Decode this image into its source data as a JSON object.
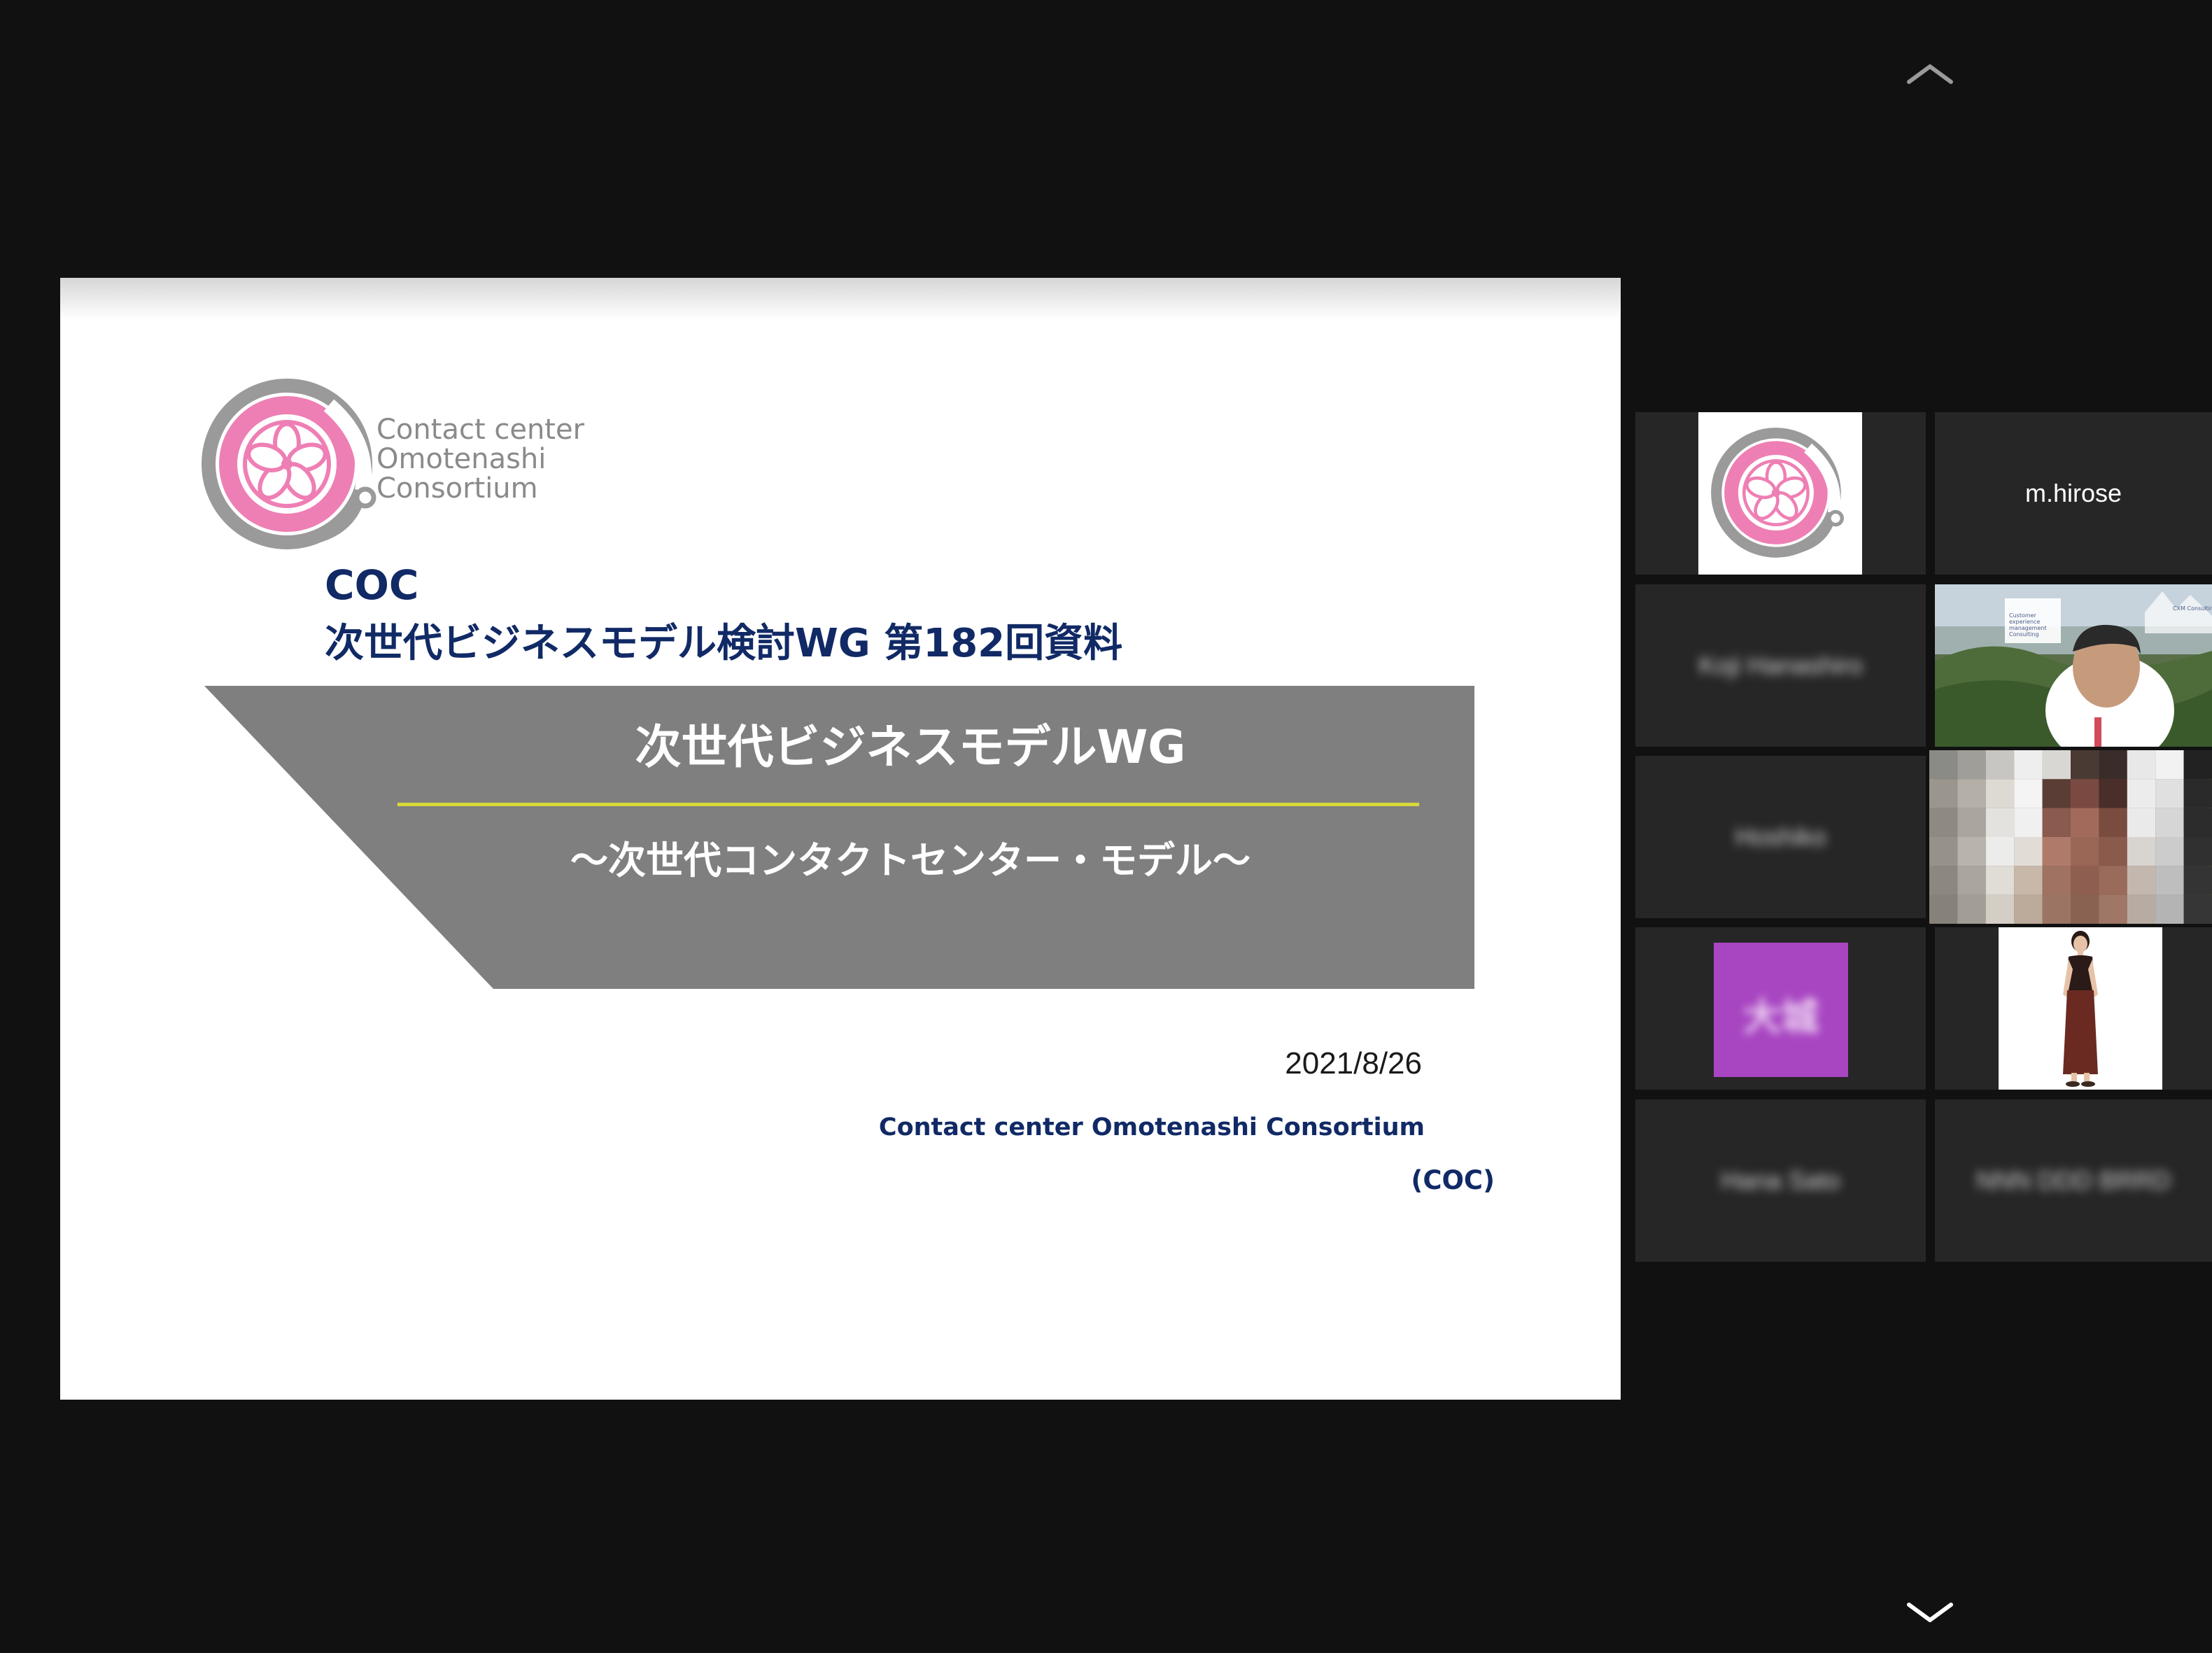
{
  "controls": {
    "scroll_up_icon": "chevron-up-icon",
    "scroll_down_icon": "chevron-down-icon"
  },
  "slide": {
    "logo_lines": [
      "Contact center",
      "Omotenashi",
      "Consortium"
    ],
    "heading_line_1": "COC",
    "heading_line_2": "次世代ビジネスモデル検討WG 第182回資料",
    "banner_title": "次世代ビジネスモデルWG",
    "banner_subtitle": "～次世代コンタクトセンター・モデル～",
    "date": "2021/8/26",
    "organization": "Contact center Omotenashi Consortium",
    "organization_abbr": "(COC)",
    "colors": {
      "heading": "#112a66",
      "banner": "#7f7f7f",
      "rule": "#d8d83c",
      "logo_pink": "#ee7fb4",
      "logo_gray": "#9a9a9a"
    }
  },
  "participants": [
    {
      "kind": "avatar-logo",
      "name": ""
    },
    {
      "kind": "name",
      "name": "m.hirose"
    },
    {
      "kind": "name-blurred",
      "name": "Koji Hanashiro"
    },
    {
      "kind": "video",
      "name": "",
      "overlay_lines": [
        "Customer",
        "experience",
        "management",
        "Consulting"
      ],
      "brand": "CXM Consulting"
    },
    {
      "kind": "name-blurred",
      "name": "Hoshiko"
    },
    {
      "kind": "video-pixelated",
      "name": "",
      "active_speaker": true
    },
    {
      "kind": "avatar-pixelated",
      "name": "",
      "avatar_text": "大城"
    },
    {
      "kind": "avatar-illustration",
      "name": ""
    },
    {
      "kind": "name-blurred",
      "name": "Hana Sato"
    },
    {
      "kind": "name-blurred",
      "name": "NNN  DDD  BRRD"
    }
  ],
  "ui_colors": {
    "background": "#111111",
    "tile": "#262626",
    "active_speaker_border": "#b6d45a"
  }
}
